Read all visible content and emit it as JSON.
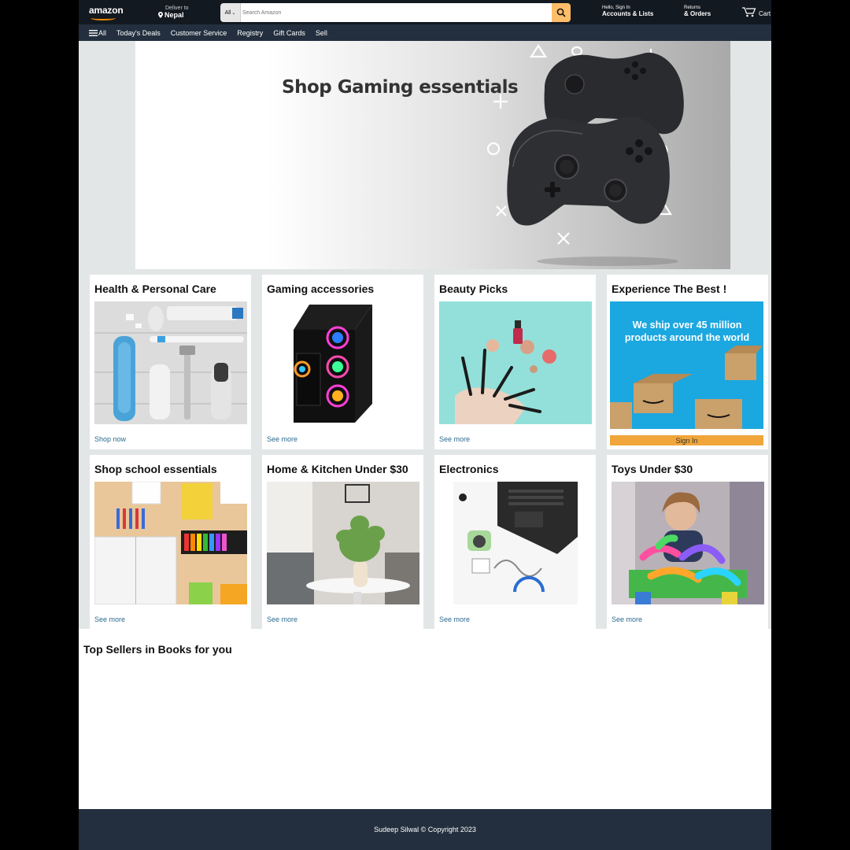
{
  "header": {
    "logo_text": "amazon",
    "deliver_label": "Deliver to",
    "deliver_location": "Nepal",
    "search_category": "All",
    "search_placeholder": "Search Amazon",
    "account_greeting": "Hello, Sign In",
    "account_label": "Accounts & Lists",
    "returns_label": "Returns",
    "orders_label": "& Orders",
    "cart_label": "Cart"
  },
  "nav": {
    "all_label": "All",
    "items": [
      "Today's Deals",
      "Customer Service",
      "Registry",
      "Gift Cards",
      "Sell"
    ]
  },
  "hero": {
    "title": "Shop Gaming essentials"
  },
  "cards": [
    {
      "title": "Health & Personal Care",
      "link": "Shop now"
    },
    {
      "title": "Gaming accessories",
      "link": "See more"
    },
    {
      "title": "Beauty Picks",
      "link": "See more"
    },
    {
      "title": "Experience The Best !",
      "promo_text": "We ship over 45 million products around the world",
      "button": "Sign In"
    },
    {
      "title": "Shop school essentials",
      "link": "See more"
    },
    {
      "title": "Home & Kitchen Under $30",
      "link": "See more"
    },
    {
      "title": "Electronics",
      "link": "See more"
    },
    {
      "title": "Toys Under $30",
      "link": "See more"
    }
  ],
  "books_section_title": "Top Sellers in Books for you",
  "footer": {
    "text": "Sudeep Silwal © Copyright 2023"
  },
  "colors": {
    "header_bg": "#131921",
    "nav_bg": "#232f3e",
    "search_button": "#febd69",
    "signin_button": "#f0a63b",
    "link": "#2c6b8e",
    "page_bg": "#e3e6e6"
  }
}
